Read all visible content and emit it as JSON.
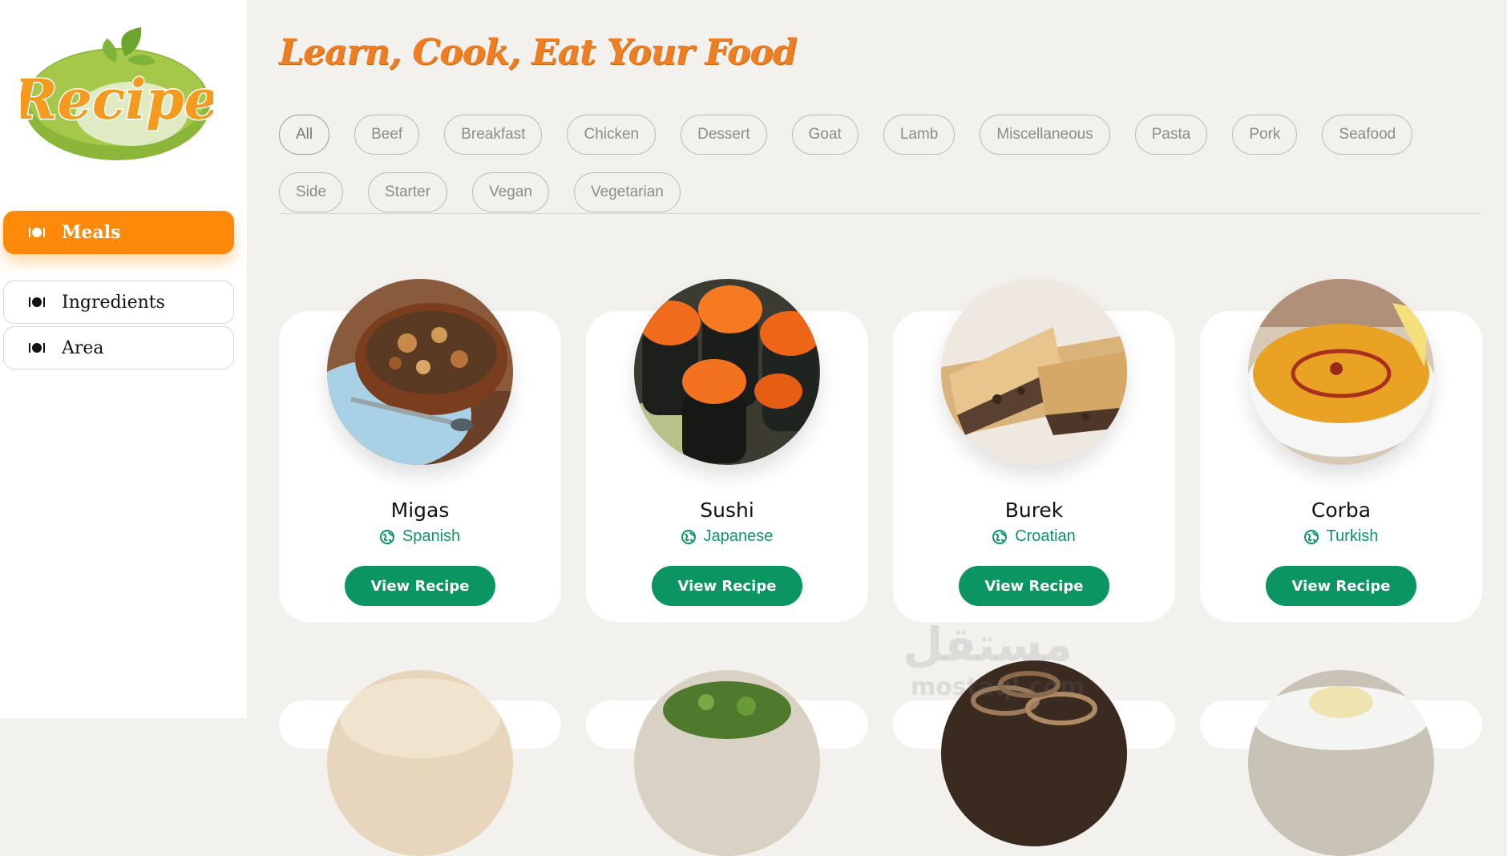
{
  "logo": {
    "text": "Recipe"
  },
  "sidebar": {
    "items": [
      {
        "label": "Meals",
        "icon": "utensils-icon",
        "active": true
      },
      {
        "label": "Ingredients",
        "icon": "utensils-icon",
        "active": false
      },
      {
        "label": "Area",
        "icon": "utensils-icon",
        "active": false
      }
    ]
  },
  "main": {
    "headline": "Learn, Cook, Eat Your Food",
    "categories": [
      "All",
      "Beef",
      "Breakfast",
      "Chicken",
      "Dessert",
      "Goat",
      "Lamb",
      "Miscellaneous",
      "Pasta",
      "Pork",
      "Seafood",
      "Side",
      "Starter",
      "Vegan",
      "Vegetarian"
    ],
    "meals": [
      {
        "name": "Migas",
        "area": "Spanish",
        "button": "View Recipe"
      },
      {
        "name": "Sushi",
        "area": "Japanese",
        "button": "View Recipe"
      },
      {
        "name": "Burek",
        "area": "Croatian",
        "button": "View Recipe"
      },
      {
        "name": "Corba",
        "area": "Turkish",
        "button": "View Recipe"
      }
    ]
  },
  "colors": {
    "accent": "#ff8a0a",
    "headline": "#ef7d22",
    "button": "#0a9563",
    "area_text": "#0f9466"
  },
  "watermark": {
    "text": "مستقل",
    "sub": "mostaql.com"
  }
}
